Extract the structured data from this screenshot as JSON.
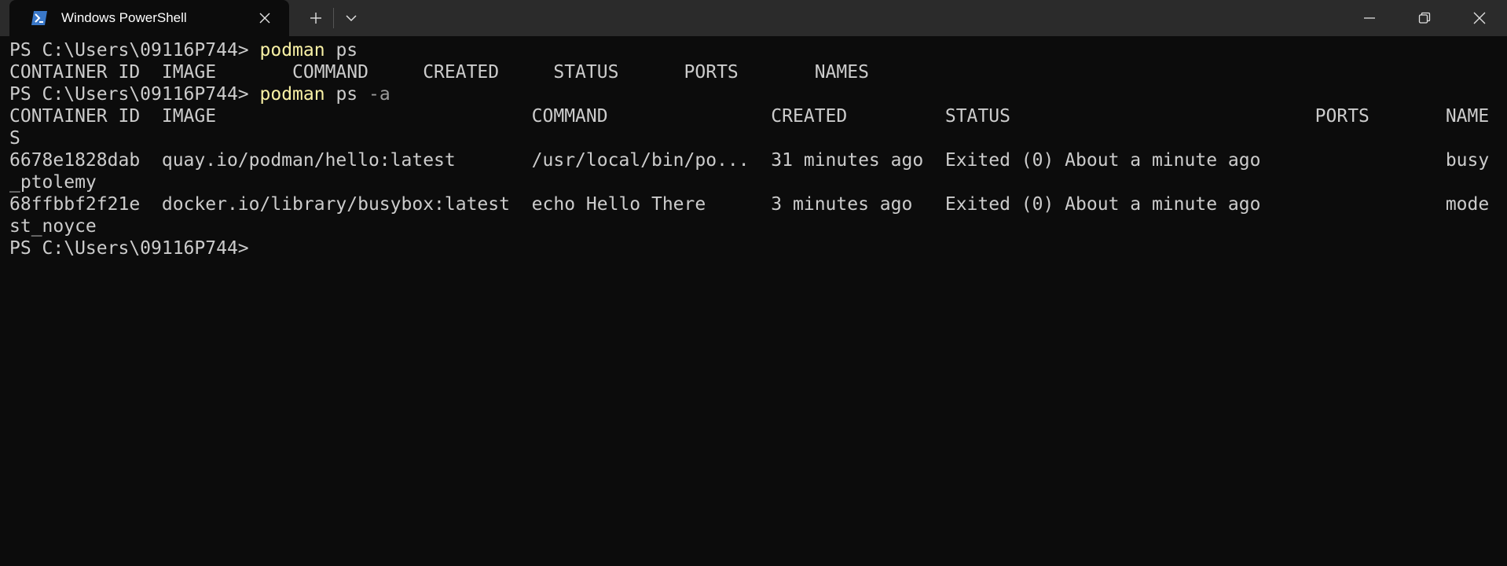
{
  "window": {
    "tab_title": "Windows PowerShell",
    "icons": {
      "tab": "powershell-icon",
      "close_tab": "close-icon",
      "new_tab": "plus-icon",
      "dropdown": "chevron-down-icon",
      "minimize": "minimize-icon",
      "maximize": "restore-icon",
      "close": "close-icon"
    },
    "colors": {
      "titlebar": "#2b2b2b",
      "background": "#0c0c0c",
      "text": "#cccccc",
      "command": "#f9f1a5",
      "parameter": "#9a9a9a",
      "powershell_icon": "#3a78c9"
    }
  },
  "terminal": {
    "prompt": "PS C:\\Users\\09116P744> ",
    "cmd1": {
      "command": "podman",
      "args": " ps"
    },
    "header1": "CONTAINER ID  IMAGE       COMMAND     CREATED     STATUS      PORTS       NAMES",
    "cmd2": {
      "command": "podman",
      "args": " ps",
      "flag": " -a"
    },
    "header2": "CONTAINER ID  IMAGE                             COMMAND               CREATED         STATUS                            PORTS       NAME",
    "header2_wrap": "S",
    "rows": [
      {
        "line": "6678e1828dab  quay.io/podman/hello:latest       /usr/local/bin/po...  31 minutes ago  Exited (0) About a minute ago                 busy",
        "wrap": "_ptolemy"
      },
      {
        "line": "68ffbbf2f21e  docker.io/library/busybox:latest  echo Hello There      3 minutes ago   Exited (0) About a minute ago                 mode",
        "wrap": "st_noyce"
      }
    ],
    "final_prompt": "PS C:\\Users\\09116P744>"
  }
}
